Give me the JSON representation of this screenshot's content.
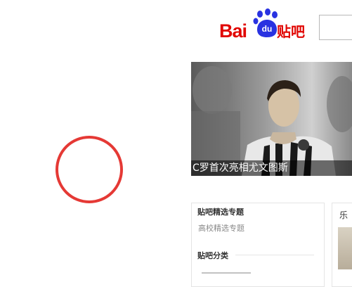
{
  "logo": {
    "bai": "Bai",
    "du": "du",
    "tieba": "贴吧",
    "brand_red": "#e10602",
    "paw_blue": "#2932e1"
  },
  "search": {
    "value": ""
  },
  "banner": {
    "caption": "C罗首次亮相尤文图斯"
  },
  "panel": {
    "title": "贴吧精选专题",
    "subtitle": "高校精选专题",
    "category": "贴吧分类"
  },
  "side_panel": {
    "text": "乐"
  },
  "annotation": {
    "color": "#e53935"
  }
}
